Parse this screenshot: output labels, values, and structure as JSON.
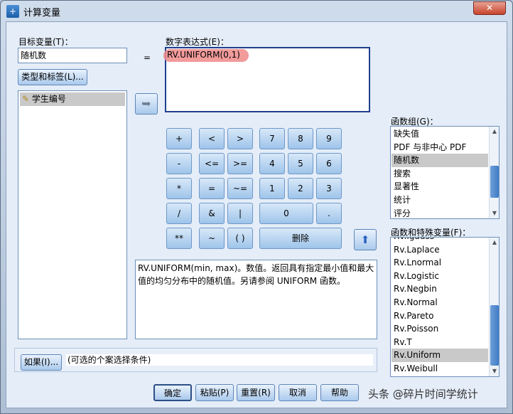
{
  "window": {
    "title": "计算变量",
    "close": "✕"
  },
  "target": {
    "label": "目标变量(T)：",
    "value": "随机数",
    "type_label_button": "类型和标签(L)..."
  },
  "equals": "=",
  "variables": [
    {
      "name": "学生编号",
      "icon": "ruler-icon"
    }
  ],
  "expression": {
    "label": "数字表达式(E)：",
    "value": "RV.UNIFORM(0,1)",
    "highlight": "#f08a8a"
  },
  "keypad": {
    "plus": "+",
    "lt": "<",
    "gt": ">",
    "k7": "7",
    "k8": "8",
    "k9": "9",
    "minus": "-",
    "le": "<=",
    "ge": ">=",
    "k4": "4",
    "k5": "5",
    "k6": "6",
    "mul": "*",
    "eq": "=",
    "ne": "~=",
    "k1": "1",
    "k2": "2",
    "k3": "3",
    "div": "/",
    "and": "&",
    "or": "|",
    "k0": "0",
    "dot": ".",
    "pow": "**",
    "not": "~",
    "paren": "( )",
    "delete": "删除"
  },
  "description": "RV.UNIFORM(min, max)。数值。返回具有指定最小值和最大值的均匀分布中的随机值。另请参阅 UNIFORM 函数。",
  "function_group": {
    "label": "函数组(G)：",
    "items": [
      "缺失值",
      "PDF 与非中心 PDF",
      "随机数",
      "搜索",
      "显著性",
      "统计",
      "评分"
    ],
    "selected": "随机数"
  },
  "functions": {
    "label": "函数和特殊变量(F)：",
    "items": [
      "Rv.Igauss",
      "Rv.Laplace",
      "Rv.Lnormal",
      "Rv.Logistic",
      "Rv.Negbin",
      "Rv.Normal",
      "Rv.Pareto",
      "Rv.Poisson",
      "Rv.T",
      "Rv.Uniform",
      "Rv.Weibull"
    ],
    "selected": "Rv.Uniform"
  },
  "condition": {
    "if_button": "如果(I)...",
    "text": "(可选的个案选择条件)"
  },
  "buttons": {
    "ok": "确定",
    "paste": "粘贴(P)",
    "reset": "重置(R)",
    "cancel": "取消",
    "help": "帮助"
  },
  "watermark": "头条 @碎片时间学统计"
}
